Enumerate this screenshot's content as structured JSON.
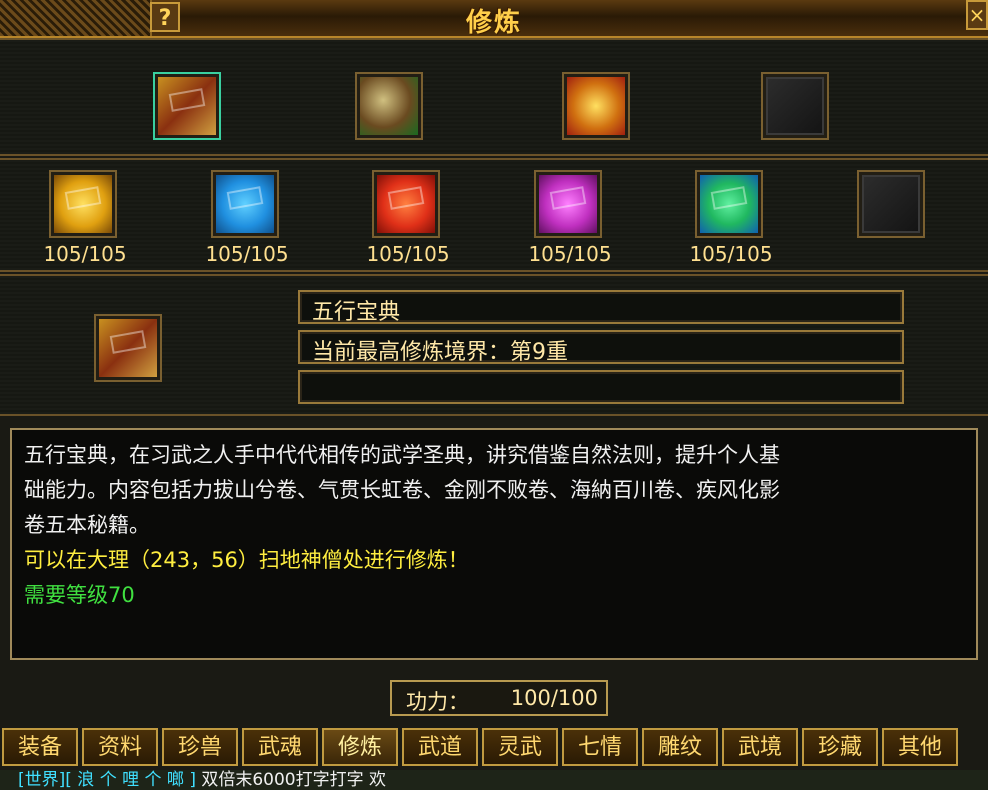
{
  "window": {
    "title": "修炼",
    "help_label": "?",
    "close_label": "×"
  },
  "top_row": [
    {
      "name": "五行宝典-icon",
      "selected": true
    },
    {
      "name": "scroll-bundle-icon",
      "selected": false
    },
    {
      "name": "gold-chest-icon",
      "selected": false
    },
    {
      "name": "empty-slot-icon",
      "selected": false
    }
  ],
  "books": [
    {
      "count": "105/105",
      "color": "#e0a010"
    },
    {
      "count": "105/105",
      "color": "#2090e0"
    },
    {
      "count": "105/105",
      "color": "#e03018"
    },
    {
      "count": "105/105",
      "color": "#c030c0"
    },
    {
      "count": "105/105",
      "color": "#20b860"
    }
  ],
  "detail": {
    "name": "五行宝典",
    "realm": "当前最高修炼境界：第9重",
    "extra": ""
  },
  "description": {
    "line1": "五行宝典，在习武之人手中代代相传的武学圣典，讲究借鉴自然法则，提升个人基",
    "line2": "础能力。内容包括力拔山兮卷、气贯长虹卷、金刚不败卷、海納百川卷、疾风化影",
    "line3": "卷五本秘籍。",
    "location": "可以在大理（243，56）扫地神僧处进行修炼！",
    "requirement": "需要等级70"
  },
  "power": {
    "label": "功力：",
    "value": "100/100"
  },
  "tabs": [
    "装备",
    "资料",
    "珍兽",
    "武魂",
    "修炼",
    "武道",
    "灵武",
    "七情",
    "雕纹",
    "武境",
    "珍藏",
    "其他"
  ],
  "active_tab": "修炼",
  "chat": {
    "channel": "[世界][ 浪 个 哩 个 啷 ]",
    "text": "双倍末6000打字打字  欢"
  }
}
